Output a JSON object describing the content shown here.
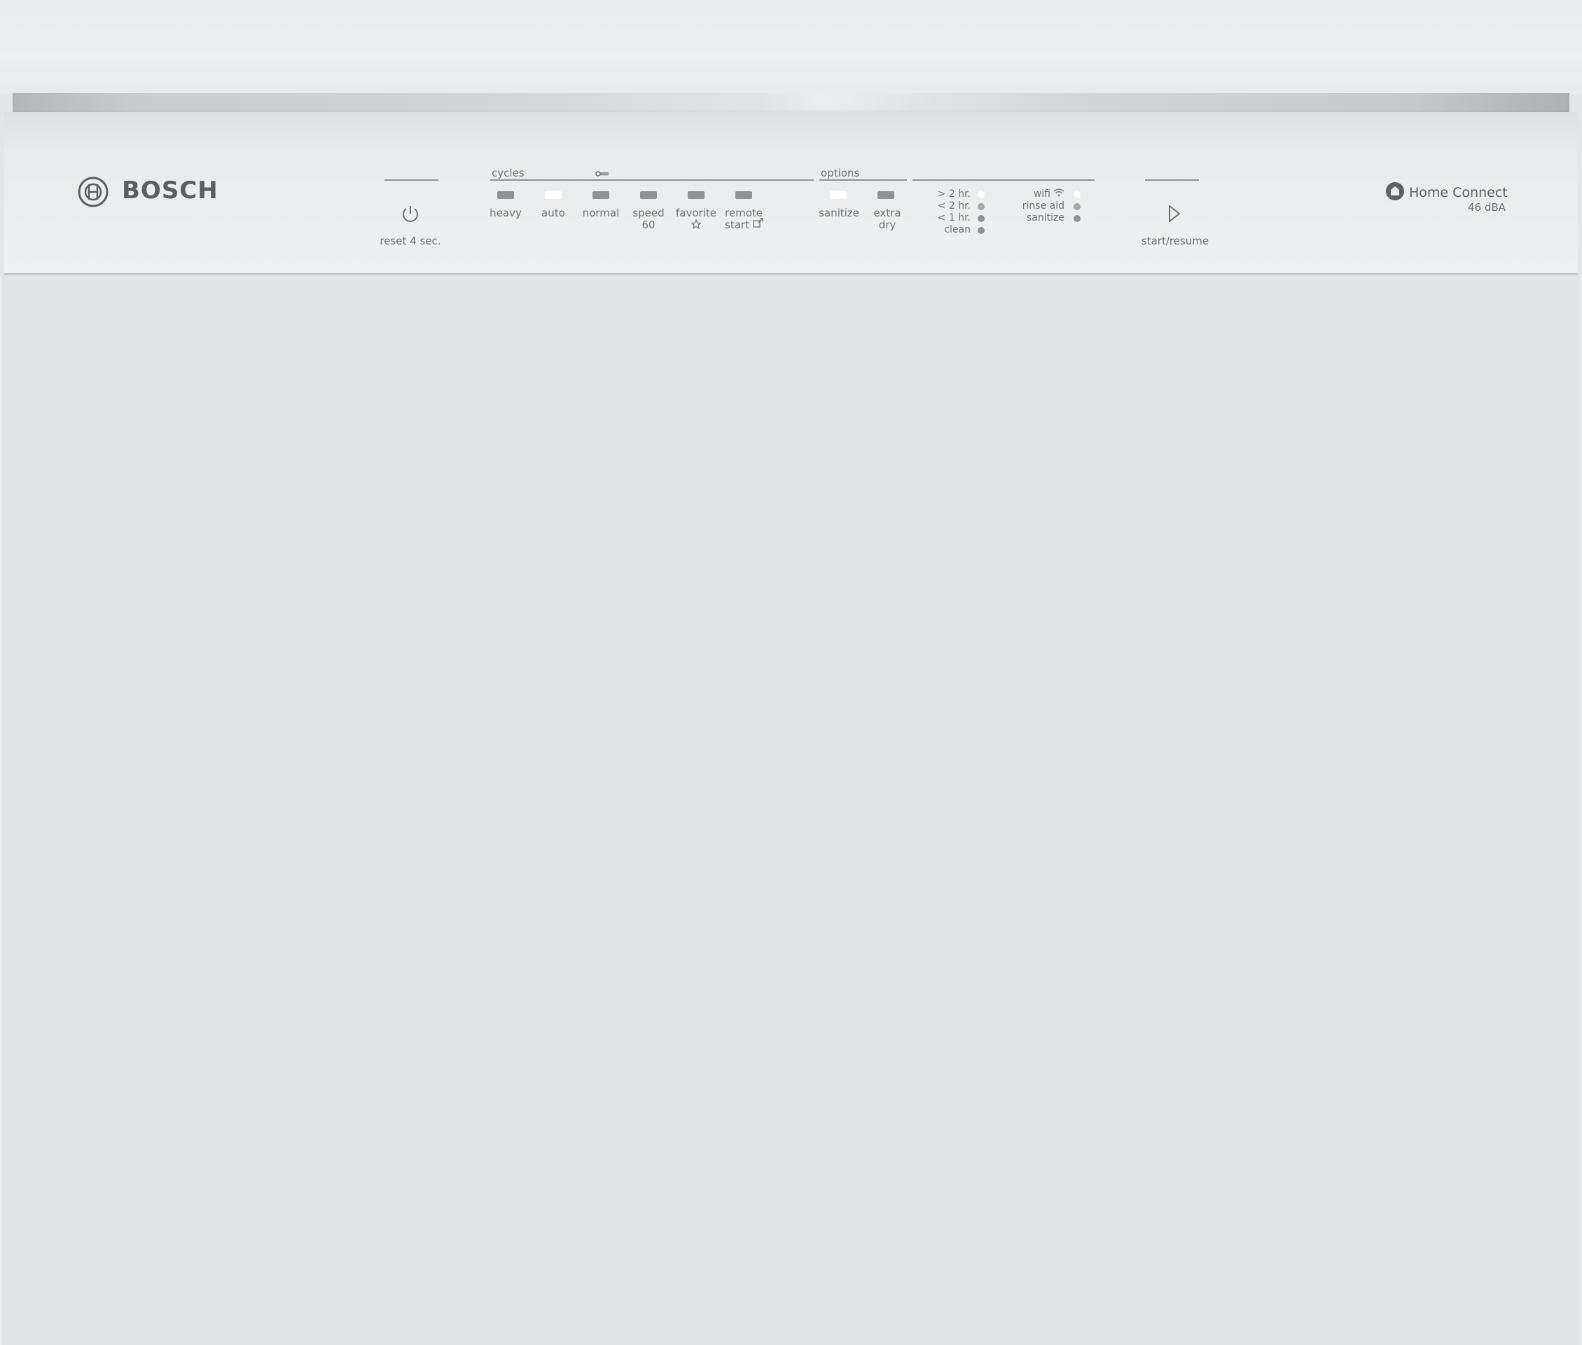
{
  "brand": {
    "name": "BOSCH"
  },
  "power": {
    "label": "reset 4 sec."
  },
  "cycles": {
    "header": "cycles",
    "items": [
      {
        "label": "heavy",
        "active": false
      },
      {
        "label": "auto",
        "active": true
      },
      {
        "label": "normal",
        "active": false
      },
      {
        "label": "speed",
        "sub": "60",
        "active": false
      },
      {
        "label": "favorite",
        "active": false
      },
      {
        "label": "remote",
        "sub": "start",
        "active": false
      }
    ]
  },
  "options": {
    "header": "options",
    "items": [
      {
        "label": "sanitize",
        "active": true
      },
      {
        "label": "extra",
        "sub": "dry",
        "active": false
      }
    ]
  },
  "time_status": [
    {
      "label": "> 2 hr.",
      "state": "on"
    },
    {
      "label": "< 2 hr.",
      "state": "dim"
    },
    {
      "label": "< 1 hr.",
      "state": "off"
    },
    {
      "label": "clean",
      "state": "off"
    }
  ],
  "status_indicators": [
    {
      "label": "wifi",
      "state": "on"
    },
    {
      "label": "rinse aid",
      "state": "dim"
    },
    {
      "label": "sanitize",
      "state": "off"
    }
  ],
  "start": {
    "label": "start/resume"
  },
  "home_connect": {
    "label": "Home Connect",
    "noise": "46 dBA"
  },
  "colors": {
    "led_on": "#ffffff",
    "led_off": "#8e9093",
    "panel": "#eceded",
    "door": "#e3e4e6",
    "text": "#6e7073"
  }
}
